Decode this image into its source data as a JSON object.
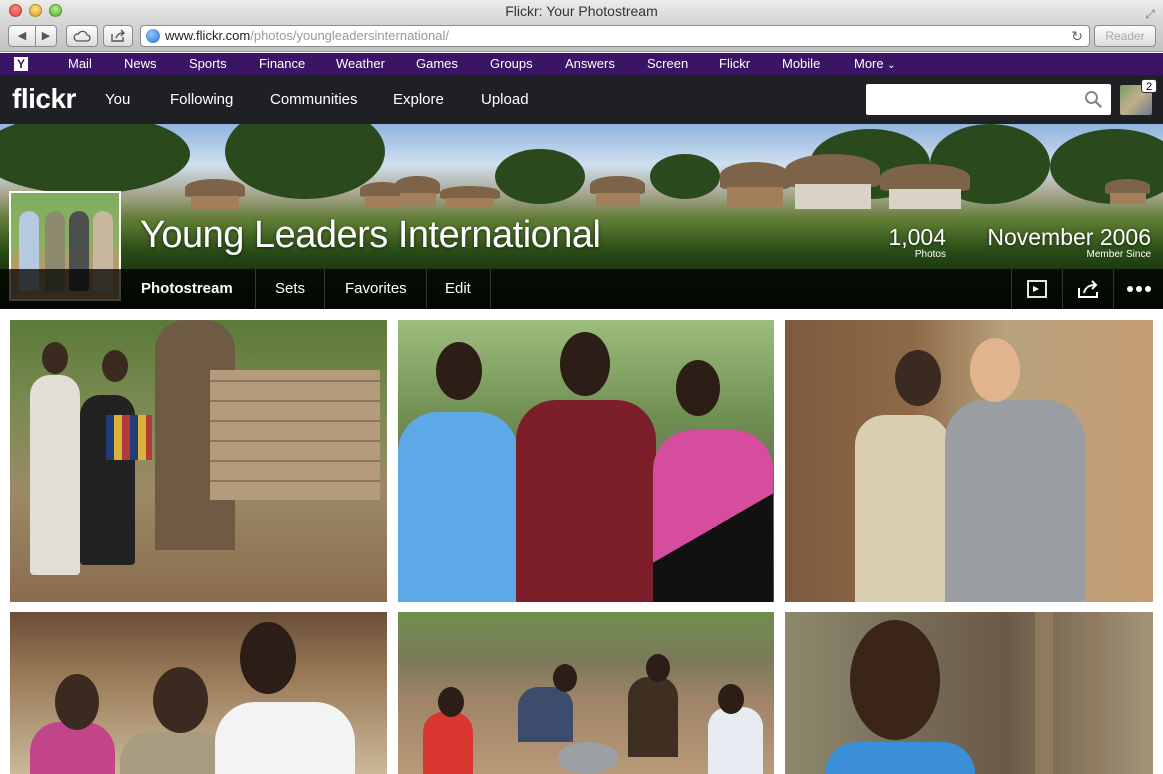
{
  "browser": {
    "window_title": "Flickr: Your Photostream",
    "url_host": "www.flickr.com",
    "url_path": "/photos/youngleadersinternational/",
    "reader_label": "Reader"
  },
  "yahoo_bar": {
    "logo": "Y",
    "items": [
      "Mail",
      "News",
      "Sports",
      "Finance",
      "Weather",
      "Games",
      "Groups",
      "Answers",
      "Screen",
      "Flickr",
      "Mobile",
      "More"
    ]
  },
  "flickr_nav": {
    "logo": "flickr",
    "items": [
      "You",
      "Following",
      "Communities",
      "Explore",
      "Upload"
    ],
    "search_placeholder": "",
    "notification_count": "2"
  },
  "profile": {
    "name": "Young Leaders International",
    "photos_count": "1,004",
    "photos_label": "Photos",
    "member_since": "November 2006",
    "member_since_label": "Member Since"
  },
  "subnav": {
    "tabs": [
      "Photostream",
      "Sets",
      "Favorites",
      "Edit"
    ],
    "active": "Photostream"
  },
  "colors": {
    "yahoo_purple": "#3a1565",
    "flickr_nav_bg": "#1e2024"
  }
}
